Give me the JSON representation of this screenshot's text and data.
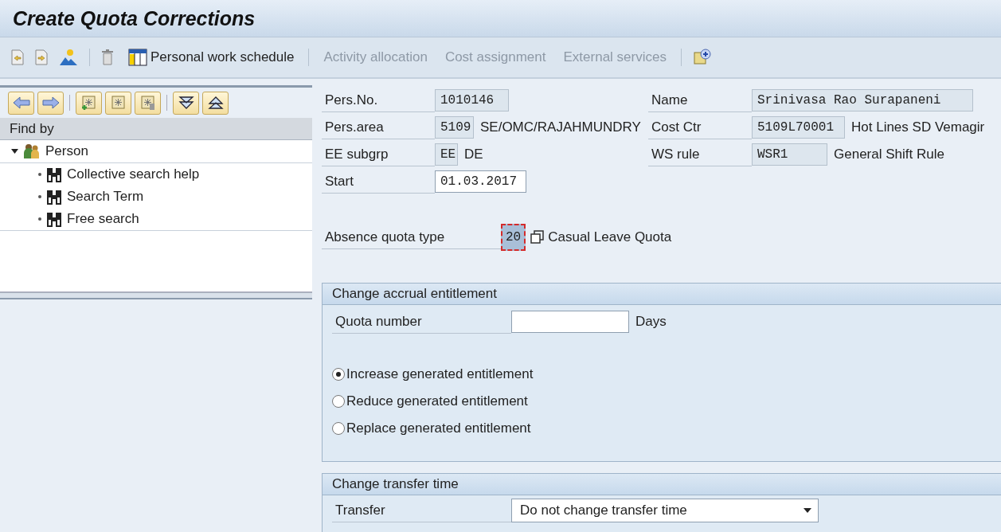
{
  "window": {
    "title": "Create Quota Corrections"
  },
  "toolbar": {
    "buttons": [
      {
        "label": "Personal work schedule",
        "disabled": false
      },
      {
        "label": "Activity allocation",
        "disabled": true
      },
      {
        "label": "Cost assignment",
        "disabled": true
      },
      {
        "label": "External services",
        "disabled": true
      }
    ]
  },
  "navigator": {
    "header": "Find by",
    "tree": [
      {
        "label": "Person",
        "expanded": true,
        "children": [
          {
            "label": "Collective search help"
          },
          {
            "label": "Search Term"
          },
          {
            "label": "Free search"
          }
        ]
      }
    ]
  },
  "header_fields": {
    "left": [
      {
        "label": "Pers.No.",
        "value": "1010146",
        "editable": false
      },
      {
        "label": "Pers.area",
        "value": "5109",
        "text": "SE/OMC/RAJAHMUNDRY",
        "editable": false
      },
      {
        "label": "EE subgrp",
        "value": "EE",
        "text": "DE",
        "editable": false
      },
      {
        "label": "Start",
        "value": "01.03.2017",
        "editable": true
      }
    ],
    "right": [
      {
        "label": "Name",
        "value": "Srinivasa Rao Surapaneni",
        "editable": false
      },
      {
        "label": "Cost Ctr",
        "value": "5109L70001",
        "text": "Hot Lines SD Vemagir",
        "editable": false
      },
      {
        "label": "WS rule",
        "value": "WSR1",
        "text": "General Shift Rule",
        "editable": false
      }
    ]
  },
  "quota_type": {
    "label": "Absence quota type",
    "value": "20",
    "text": "Casual Leave Quota",
    "focused": true
  },
  "accrual_group": {
    "title": "Change accrual entitlement",
    "quota_label": "Quota number",
    "unit": "Days",
    "radios": [
      {
        "label": "Increase generated entitlement",
        "selected": true
      },
      {
        "label": "Reduce generated entitlement",
        "selected": false
      },
      {
        "label": "Replace generated entitlement",
        "selected": false
      }
    ]
  },
  "transfer_group": {
    "title": "Change transfer time",
    "label": "Transfer",
    "value": "Do not change transfer time"
  }
}
